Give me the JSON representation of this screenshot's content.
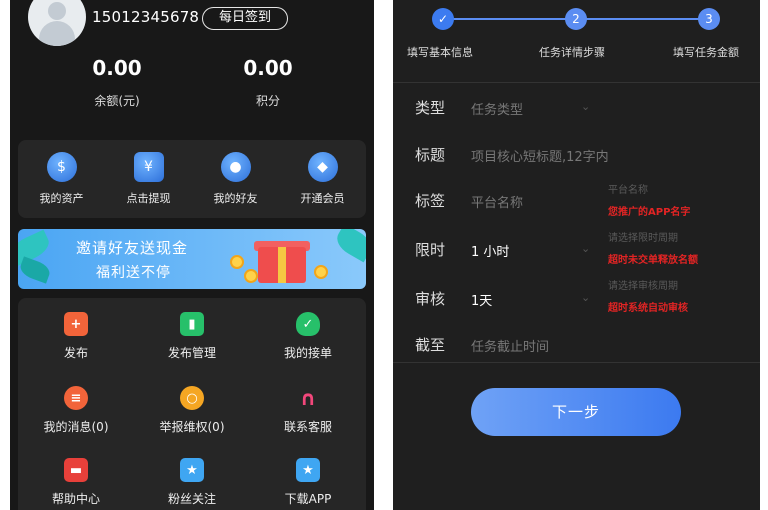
{
  "left": {
    "user": {
      "phone": "15012345678",
      "checkin_label": "每日签到"
    },
    "stats": [
      {
        "value": "0.00",
        "label": "余额(元)"
      },
      {
        "value": "0.00",
        "label": "积分"
      }
    ],
    "quick": [
      {
        "label": "我的资产",
        "icon": "coin-icon"
      },
      {
        "label": "点击提现",
        "icon": "withdraw-icon"
      },
      {
        "label": "我的好友",
        "icon": "friends-icon"
      },
      {
        "label": "开通会员",
        "icon": "diamond-icon"
      }
    ],
    "banner": {
      "line1": "邀请好友送现金",
      "line2": "福利送不停"
    },
    "grid": [
      {
        "label": "发布",
        "icon": "plus-icon",
        "color": "#f2643a"
      },
      {
        "label": "发布管理",
        "icon": "bar-chart-icon",
        "color": "#27c06a"
      },
      {
        "label": "我的接单",
        "icon": "shield-check-icon",
        "color": "#27c06a"
      },
      {
        "label": "我的消息(0)",
        "icon": "message-icon",
        "color": "#f2643a"
      },
      {
        "label": "举报维权(0)",
        "icon": "search-icon",
        "color": "#f5a623"
      },
      {
        "label": "联系客服",
        "icon": "headset-icon",
        "color": "#f2477b"
      },
      {
        "label": "帮助中心",
        "icon": "help-box-icon",
        "color": "#e8403a"
      },
      {
        "label": "粉丝关注",
        "icon": "star-icon",
        "color": "#3fa6f2"
      },
      {
        "label": "下载APP",
        "icon": "star-icon",
        "color": "#3fa6f2"
      }
    ]
  },
  "right": {
    "steps": [
      {
        "label": "填写基本信息",
        "number": "✓"
      },
      {
        "label": "任务详情步骤",
        "number": "2"
      },
      {
        "label": "填写任务金额",
        "number": "3"
      }
    ],
    "fields": [
      {
        "label": "类型",
        "value": "任务类型"
      },
      {
        "label": "标题",
        "value": "项目核心短标题,12字内"
      },
      {
        "label": "标签",
        "value": "平台名称"
      },
      {
        "label": "限时",
        "value": "1 小时"
      },
      {
        "label": "审核",
        "value": "1天"
      },
      {
        "label": "截至",
        "value": "任务截止时间"
      }
    ],
    "hints": {
      "tag_hint": "平台名称",
      "tag_warn": "您推广的APP名字",
      "limit_hint": "请选择限时周期",
      "limit_warn": "超时未交单释放名额",
      "review_hint": "请选择审核周期",
      "review_warn": "超时系统自动审核"
    },
    "next_label": "下一步"
  }
}
